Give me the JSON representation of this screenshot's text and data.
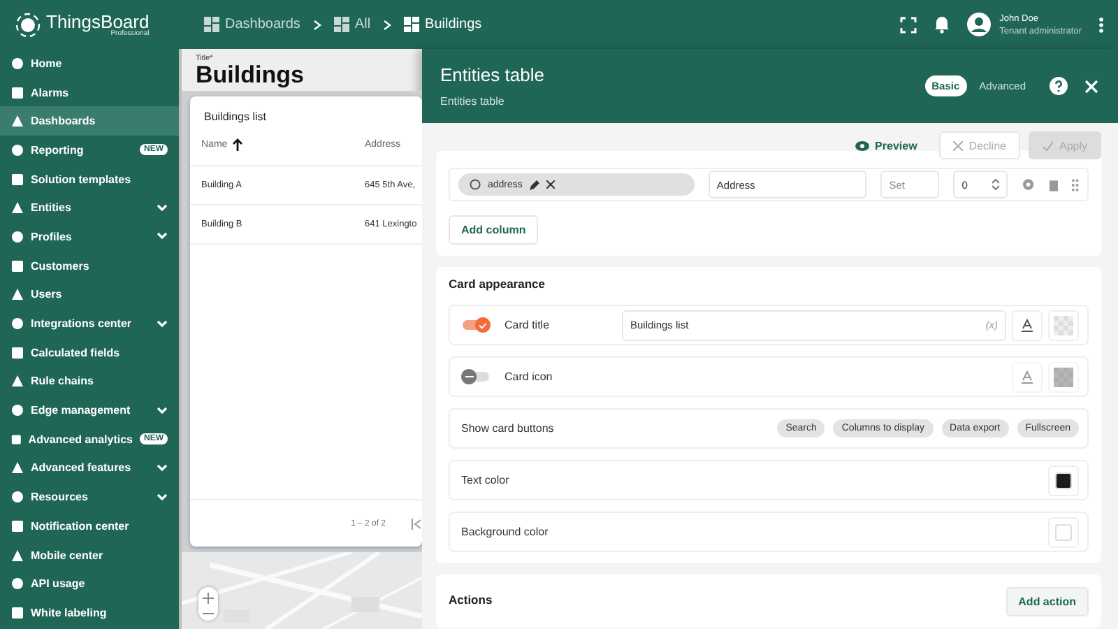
{
  "app": {
    "logo": "ThingsBoard",
    "edition": "Professional"
  },
  "breadcrumb": [
    {
      "label": "Dashboards"
    },
    {
      "label": "All"
    },
    {
      "label": "Buildings"
    }
  ],
  "user": {
    "name": "John Doe",
    "role": "Tenant administrator"
  },
  "sidebar": {
    "items": [
      {
        "label": "Home",
        "selected": false
      },
      {
        "label": "Alarms",
        "selected": false
      },
      {
        "label": "Dashboards",
        "selected": true
      },
      {
        "label": "Reporting",
        "selected": false,
        "badge": "NEW"
      },
      {
        "label": "Solution templates",
        "selected": false
      },
      {
        "label": "Entities",
        "selected": false,
        "expandable": true
      },
      {
        "label": "Profiles",
        "selected": false,
        "expandable": true
      },
      {
        "label": "Customers",
        "selected": false
      },
      {
        "label": "Users",
        "selected": false
      },
      {
        "label": "Integrations center",
        "selected": false,
        "expandable": true
      },
      {
        "label": "Calculated fields",
        "selected": false
      },
      {
        "label": "Rule chains",
        "selected": false
      },
      {
        "label": "Edge management",
        "selected": false,
        "expandable": true
      },
      {
        "label": "Advanced analytics",
        "selected": false,
        "badge": "NEW"
      },
      {
        "label": "Advanced features",
        "selected": false,
        "expandable": true
      },
      {
        "label": "Resources",
        "selected": false,
        "expandable": true
      },
      {
        "label": "Notification center",
        "selected": false
      },
      {
        "label": "Mobile center",
        "selected": false
      },
      {
        "label": "API usage",
        "selected": false
      },
      {
        "label": "White labeling",
        "selected": false
      }
    ]
  },
  "dashboard": {
    "title_label": "Title*",
    "title": "Buildings",
    "widget": {
      "title": "Buildings list",
      "columns": [
        {
          "label": "Name",
          "sorted": true
        },
        {
          "label": "Address",
          "sorted": false
        }
      ],
      "rows": [
        [
          "Building A",
          "645 5th Ave,"
        ],
        [
          "Building B",
          "641 Lexingto"
        ]
      ],
      "paginator": "1 – 2 of 2"
    }
  },
  "panel": {
    "title": "Entities table",
    "subtitle": "Entities table",
    "modes": [
      {
        "label": "Basic",
        "selected": true
      },
      {
        "label": "Advanced",
        "selected": false
      }
    ],
    "toolbar": [
      {
        "label": "Preview",
        "disabled": false,
        "kind": "preview"
      },
      {
        "label": "Decline",
        "disabled": true,
        "kind": "decline"
      },
      {
        "label": "Apply",
        "disabled": true,
        "kind": "apply"
      }
    ],
    "column_row": {
      "key": "address",
      "label": "Address",
      "width_placeholder": "Set",
      "order": "0"
    },
    "add_column": "Add column",
    "card_appearance": {
      "title": "Card appearance",
      "rows": [
        {
          "kind": "toggle",
          "label": "Card title",
          "on": true,
          "value": "Buildings list",
          "hint": "(x)"
        },
        {
          "kind": "toggle",
          "label": "Card icon",
          "on": false
        },
        {
          "kind": "chips",
          "label": "Show card buttons",
          "chips": [
            "Search",
            "Columns to display",
            "Data export",
            "Fullscreen"
          ]
        },
        {
          "kind": "color",
          "label": "Text color",
          "color": "#1c1c1c"
        },
        {
          "kind": "color",
          "label": "Background color",
          "color": "#ffffff"
        }
      ]
    },
    "actions": {
      "title": "Actions",
      "button": "Add action"
    }
  }
}
